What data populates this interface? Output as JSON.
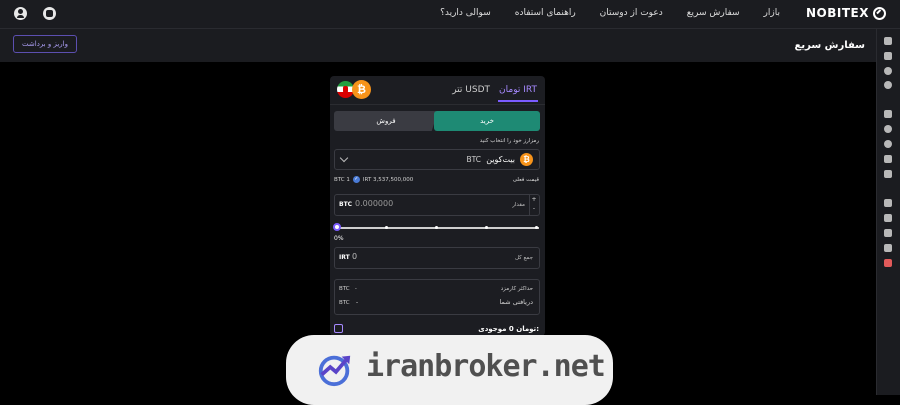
{
  "header": {
    "brand": "NOBITEX",
    "nav": [
      "بازار",
      "سفارش سریع",
      "دعوت از دوستان",
      "راهنمای استفاده",
      "سوالی دارید؟"
    ]
  },
  "subheader": {
    "title": "سفارش سریع",
    "deposit_button": "واریز و برداشت"
  },
  "order_card": {
    "tabs": {
      "irt": "تومان IRT",
      "usdt": "تتر USDT"
    },
    "buy_label": "خرید",
    "sell_label": "فروش",
    "select_prompt": "رمزارز خود را انتخاب کنید",
    "coin": {
      "name": "بیت‌کوین",
      "symbol": "BTC",
      "icon": "₿"
    },
    "price": {
      "btc": "BTC 1",
      "irt": "IRT 3,537,500,000",
      "label": "قیمت فعلی"
    },
    "amount": {
      "unit": "BTC",
      "value": "0.000000",
      "label": "مقدار",
      "plus": "+",
      "minus": "-"
    },
    "slider_percent": "0%",
    "slider_value": 0,
    "total": {
      "unit": "IRT",
      "value": "0",
      "label": "جمع کل"
    },
    "fee": {
      "max_fee_label": "حداکثر کارمزد",
      "max_fee_unit": "BTC",
      "max_fee_value": "-",
      "receive_label": "دریافتی شما",
      "receive_unit": "BTC",
      "receive_value": "-"
    },
    "balance": {
      "label": "موجودی:",
      "value": "0",
      "unit": "تومان"
    }
  },
  "watermark": {
    "text": "iranbroker.net"
  },
  "colors": {
    "accent": "#7b5cff",
    "buy": "#1e8a74",
    "btc": "#f7931a",
    "logout": "#e25a5a"
  }
}
